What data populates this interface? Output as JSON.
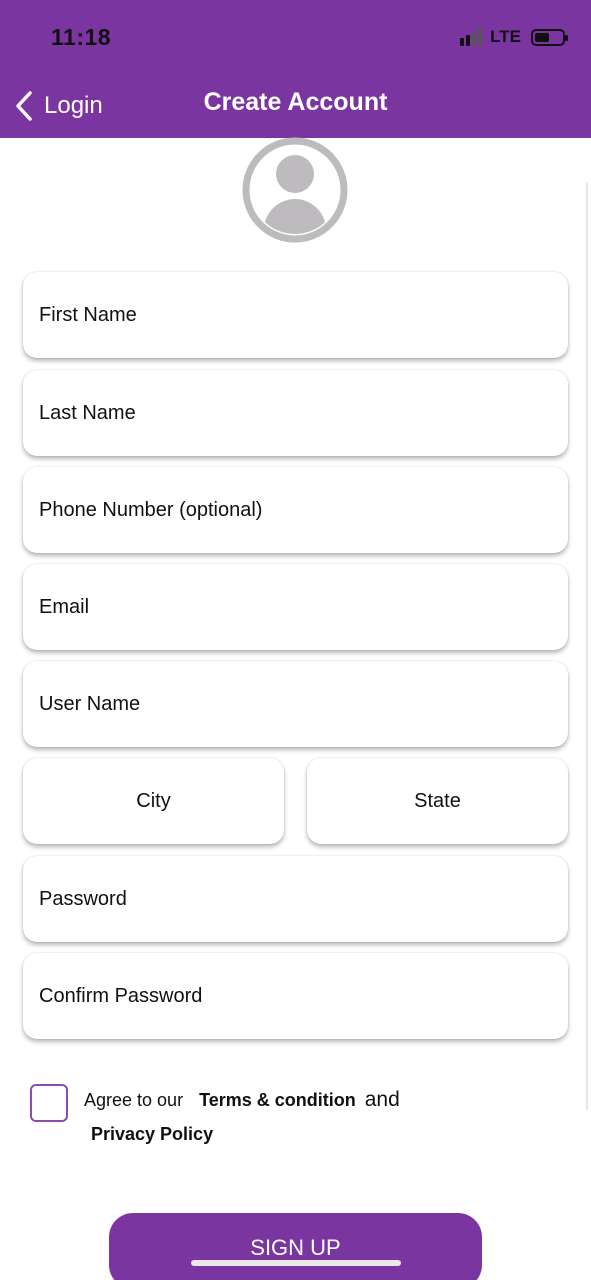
{
  "status_bar": {
    "time": "11:18",
    "network": "LTE",
    "battery_level": 0.55
  },
  "nav": {
    "back_label": "Login",
    "title": "Create Account"
  },
  "form": {
    "first_name_placeholder": "First Name",
    "last_name_placeholder": "Last Name",
    "phone_placeholder": "Phone Number (optional)",
    "email_placeholder": "Email",
    "username_placeholder": "User Name",
    "city_placeholder": "City",
    "state_placeholder": "State",
    "password_placeholder": "Password",
    "confirm_password_placeholder": "Confirm Password"
  },
  "agreement": {
    "checked": false,
    "prefix": "Agree to our",
    "terms_label": "Terms & condition",
    "and_text": "and",
    "privacy_label": "Privacy Policy"
  },
  "actions": {
    "signup_label": "SIGN UP"
  },
  "colors": {
    "brand_purple": "#7b35a0",
    "avatar_gray": "#bdbbbd"
  }
}
